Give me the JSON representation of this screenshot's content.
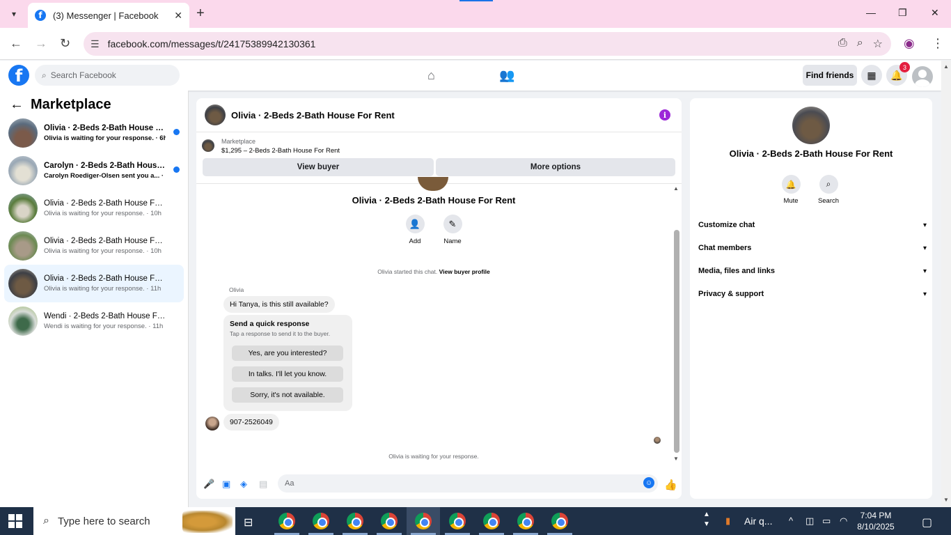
{
  "browser": {
    "tab_title": "(3) Messenger | Facebook",
    "url": "facebook.com/messages/t/24175389942130361"
  },
  "fb_header": {
    "search_placeholder": "Search Facebook",
    "find_friends": "Find friends",
    "notification_count": "3"
  },
  "sidebar": {
    "title": "Marketplace",
    "conversations": [
      {
        "name": "Olivia · 2-Beds 2-Bath House For...",
        "snippet": "Olivia is waiting for your response. · 6h",
        "unread": true
      },
      {
        "name": "Carolyn · 2-Beds 2-Bath House F...",
        "snippet": "Carolyn Roediger-Olsen sent you a... · 6h",
        "unread": true
      },
      {
        "name": "Olivia · 2-Beds 2-Bath House For R...",
        "snippet": "Olivia is waiting for your response. · 10h",
        "unread": false
      },
      {
        "name": "Olivia · 2-Beds 2-Bath House For R...",
        "snippet": "Olivia is waiting for your response. · 10h",
        "unread": false
      },
      {
        "name": "Olivia · 2-Beds 2-Bath House For R...",
        "snippet": "Olivia is waiting for your response. · 11h",
        "unread": false,
        "selected": true
      },
      {
        "name": "Wendi · 2-Beds 2-Bath House For ...",
        "snippet": "Wendi is waiting for your response. · 11h",
        "unread": false
      }
    ]
  },
  "chat": {
    "title": "Olivia · 2-Beds 2-Bath House For Rent",
    "marketplace_label": "Marketplace",
    "listing": "$1,295 – 2-Beds 2-Bath House For Rent",
    "view_buyer": "View buyer",
    "more_options": "More options",
    "body_name": "Olivia · 2-Beds 2-Bath House For Rent",
    "add_label": "Add",
    "name_label": "Name",
    "started_text": "Olivia started this chat.",
    "view_buyer_profile": "View buyer profile",
    "sender": "Olivia",
    "first_message": "Hi Tanya, is this still available?",
    "quick_title": "Send a quick response",
    "quick_subtitle": "Tap a response to send it to the buyer.",
    "quick_responses": [
      "Yes, are you interested?",
      "In talks. I'll let you know.",
      "Sorry, it's not available."
    ],
    "phone_message": "907-2526049",
    "waiting_text": "Olivia is waiting for your response.",
    "composer_placeholder": "Aa"
  },
  "right_panel": {
    "name": "Olivia · 2-Beds 2-Bath House For Rent",
    "mute": "Mute",
    "search": "Search",
    "sections": [
      "Customize chat",
      "Chat members",
      "Media, files and links",
      "Privacy & support"
    ]
  },
  "taskbar": {
    "search_placeholder": "Type here to search",
    "tray_app": "Air q...",
    "time": "7:04 PM",
    "date": "8/10/2025"
  }
}
